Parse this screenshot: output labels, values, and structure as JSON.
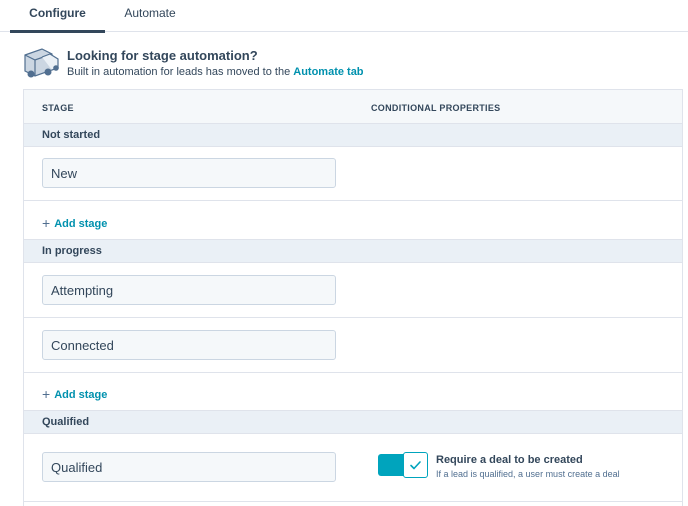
{
  "tabs": [
    {
      "label": "Configure",
      "active": true
    },
    {
      "label": "Automate",
      "active": false
    }
  ],
  "banner": {
    "icon": "delivery-truck-icon",
    "title": "Looking for stage automation?",
    "text": "Built in automation for leads has moved to the",
    "link": "Automate tab"
  },
  "table": {
    "headers": {
      "stage": "STAGE",
      "conditional": "CONDITIONAL PROPERTIES"
    },
    "groups": [
      {
        "label": "Not started",
        "stages": [
          "New"
        ],
        "add_label": "Add stage"
      },
      {
        "label": "In progress",
        "stages": [
          "Attempting",
          "Connected"
        ],
        "add_label": "Add stage"
      },
      {
        "label": "Qualified",
        "stages": [
          "Qualified"
        ]
      }
    ],
    "qualified_condition": {
      "toggle_on": true,
      "title": "Require a deal to be created",
      "subtitle": "If a lead is qualified, a user must create a deal"
    }
  },
  "colors": {
    "accent": "#00a4bd",
    "link": "#0091ae",
    "text": "#33475b",
    "header_bg": "#f5f8fa",
    "group_bg": "#eaf0f6"
  }
}
